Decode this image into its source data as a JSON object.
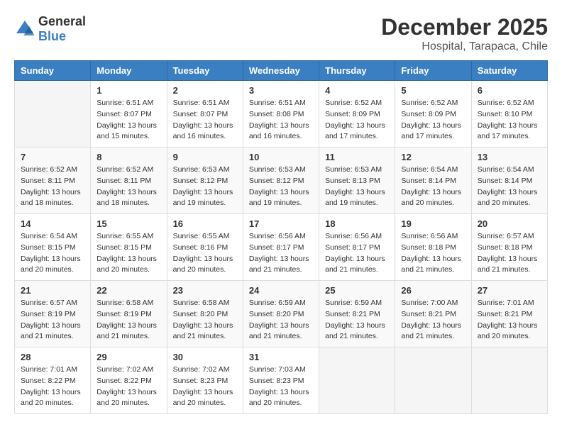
{
  "logo": {
    "general": "General",
    "blue": "Blue"
  },
  "header": {
    "month": "December 2025",
    "location": "Hospital, Tarapaca, Chile"
  },
  "weekdays": [
    "Sunday",
    "Monday",
    "Tuesday",
    "Wednesday",
    "Thursday",
    "Friday",
    "Saturday"
  ],
  "weeks": [
    [
      {
        "day": "",
        "info": ""
      },
      {
        "day": "1",
        "info": "Sunrise: 6:51 AM\nSunset: 8:07 PM\nDaylight: 13 hours\nand 15 minutes."
      },
      {
        "day": "2",
        "info": "Sunrise: 6:51 AM\nSunset: 8:07 PM\nDaylight: 13 hours\nand 16 minutes."
      },
      {
        "day": "3",
        "info": "Sunrise: 6:51 AM\nSunset: 8:08 PM\nDaylight: 13 hours\nand 16 minutes."
      },
      {
        "day": "4",
        "info": "Sunrise: 6:52 AM\nSunset: 8:09 PM\nDaylight: 13 hours\nand 17 minutes."
      },
      {
        "day": "5",
        "info": "Sunrise: 6:52 AM\nSunset: 8:09 PM\nDaylight: 13 hours\nand 17 minutes."
      },
      {
        "day": "6",
        "info": "Sunrise: 6:52 AM\nSunset: 8:10 PM\nDaylight: 13 hours\nand 17 minutes."
      }
    ],
    [
      {
        "day": "7",
        "info": "Sunrise: 6:52 AM\nSunset: 8:11 PM\nDaylight: 13 hours\nand 18 minutes."
      },
      {
        "day": "8",
        "info": "Sunrise: 6:52 AM\nSunset: 8:11 PM\nDaylight: 13 hours\nand 18 minutes."
      },
      {
        "day": "9",
        "info": "Sunrise: 6:53 AM\nSunset: 8:12 PM\nDaylight: 13 hours\nand 19 minutes."
      },
      {
        "day": "10",
        "info": "Sunrise: 6:53 AM\nSunset: 8:12 PM\nDaylight: 13 hours\nand 19 minutes."
      },
      {
        "day": "11",
        "info": "Sunrise: 6:53 AM\nSunset: 8:13 PM\nDaylight: 13 hours\nand 19 minutes."
      },
      {
        "day": "12",
        "info": "Sunrise: 6:54 AM\nSunset: 8:14 PM\nDaylight: 13 hours\nand 20 minutes."
      },
      {
        "day": "13",
        "info": "Sunrise: 6:54 AM\nSunset: 8:14 PM\nDaylight: 13 hours\nand 20 minutes."
      }
    ],
    [
      {
        "day": "14",
        "info": "Sunrise: 6:54 AM\nSunset: 8:15 PM\nDaylight: 13 hours\nand 20 minutes."
      },
      {
        "day": "15",
        "info": "Sunrise: 6:55 AM\nSunset: 8:15 PM\nDaylight: 13 hours\nand 20 minutes."
      },
      {
        "day": "16",
        "info": "Sunrise: 6:55 AM\nSunset: 8:16 PM\nDaylight: 13 hours\nand 20 minutes."
      },
      {
        "day": "17",
        "info": "Sunrise: 6:56 AM\nSunset: 8:17 PM\nDaylight: 13 hours\nand 21 minutes."
      },
      {
        "day": "18",
        "info": "Sunrise: 6:56 AM\nSunset: 8:17 PM\nDaylight: 13 hours\nand 21 minutes."
      },
      {
        "day": "19",
        "info": "Sunrise: 6:56 AM\nSunset: 8:18 PM\nDaylight: 13 hours\nand 21 minutes."
      },
      {
        "day": "20",
        "info": "Sunrise: 6:57 AM\nSunset: 8:18 PM\nDaylight: 13 hours\nand 21 minutes."
      }
    ],
    [
      {
        "day": "21",
        "info": "Sunrise: 6:57 AM\nSunset: 8:19 PM\nDaylight: 13 hours\nand 21 minutes."
      },
      {
        "day": "22",
        "info": "Sunrise: 6:58 AM\nSunset: 8:19 PM\nDaylight: 13 hours\nand 21 minutes."
      },
      {
        "day": "23",
        "info": "Sunrise: 6:58 AM\nSunset: 8:20 PM\nDaylight: 13 hours\nand 21 minutes."
      },
      {
        "day": "24",
        "info": "Sunrise: 6:59 AM\nSunset: 8:20 PM\nDaylight: 13 hours\nand 21 minutes."
      },
      {
        "day": "25",
        "info": "Sunrise: 6:59 AM\nSunset: 8:21 PM\nDaylight: 13 hours\nand 21 minutes."
      },
      {
        "day": "26",
        "info": "Sunrise: 7:00 AM\nSunset: 8:21 PM\nDaylight: 13 hours\nand 21 minutes."
      },
      {
        "day": "27",
        "info": "Sunrise: 7:01 AM\nSunset: 8:21 PM\nDaylight: 13 hours\nand 20 minutes."
      }
    ],
    [
      {
        "day": "28",
        "info": "Sunrise: 7:01 AM\nSunset: 8:22 PM\nDaylight: 13 hours\nand 20 minutes."
      },
      {
        "day": "29",
        "info": "Sunrise: 7:02 AM\nSunset: 8:22 PM\nDaylight: 13 hours\nand 20 minutes."
      },
      {
        "day": "30",
        "info": "Sunrise: 7:02 AM\nSunset: 8:23 PM\nDaylight: 13 hours\nand 20 minutes."
      },
      {
        "day": "31",
        "info": "Sunrise: 7:03 AM\nSunset: 8:23 PM\nDaylight: 13 hours\nand 20 minutes."
      },
      {
        "day": "",
        "info": ""
      },
      {
        "day": "",
        "info": ""
      },
      {
        "day": "",
        "info": ""
      }
    ]
  ]
}
